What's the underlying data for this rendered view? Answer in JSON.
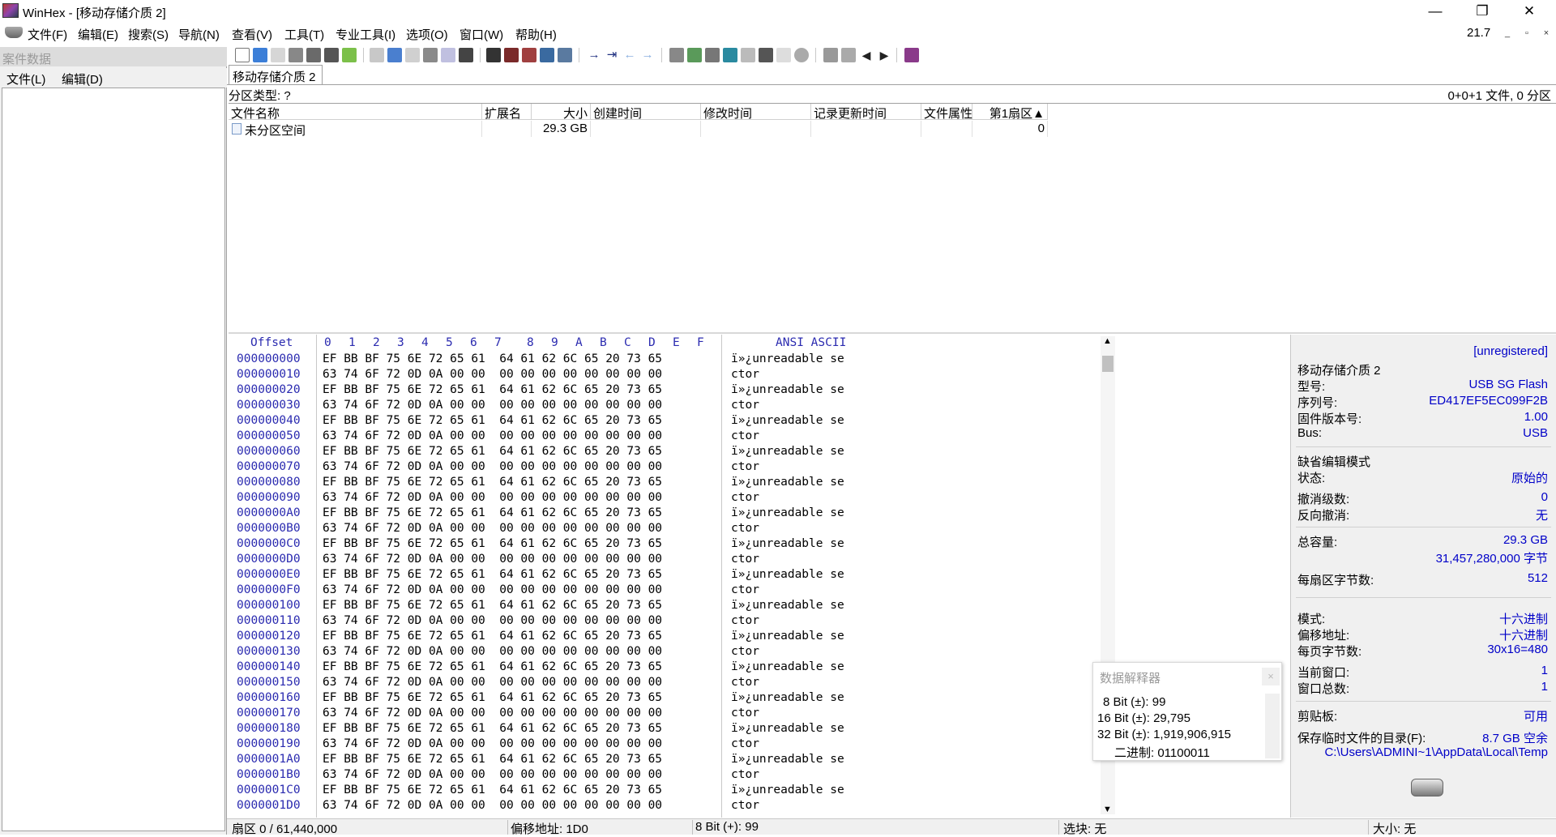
{
  "window": {
    "title": "WinHex - [移动存储介质 2]",
    "minimize": "—",
    "restore": "❐",
    "close": "✕"
  },
  "menu": {
    "items": [
      "文件(F)",
      "编辑(E)",
      "搜索(S)",
      "导航(N)",
      "查看(V)",
      "工具(T)",
      "专业工具(I)",
      "选项(O)",
      "窗口(W)",
      "帮助(H)"
    ],
    "version": "21.7",
    "mini_min": "_",
    "mini_restore": "▫",
    "mini_close": "×"
  },
  "left_panel": {
    "header": "案件数据",
    "menu": [
      "文件(L)",
      "编辑(D)"
    ]
  },
  "tab": {
    "label": "移动存储介质 2"
  },
  "partition": {
    "type_label": "分区类型: ?",
    "summary": "0+0+1 文件, 0 分区"
  },
  "file_table": {
    "headers": [
      "文件名称",
      "扩展名",
      "大小",
      "创建时间",
      "修改时间",
      "记录更新时间",
      "文件属性",
      "第1扇区▲"
    ],
    "rows": [
      {
        "name": "未分区空间",
        "ext": "",
        "size": "29.3 GB",
        "created": "",
        "modified": "",
        "record": "",
        "attr": "",
        "first_sector": "0"
      }
    ]
  },
  "hex": {
    "offset_header": "Offset",
    "col_headers": [
      "0",
      "1",
      "2",
      "3",
      "4",
      "5",
      "6",
      "7",
      "8",
      "9",
      "A",
      "B",
      "C",
      "D",
      "E",
      "F"
    ],
    "ascii_header": "ANSI ASCII",
    "row_a_bytes": "EF BB BF 75 6E 72 65 61  64 61 62 6C 65 20 73 65",
    "row_a_text": "ï»¿unreadable se",
    "row_b_bytes": "63 74 6F 72 0D 0A 00 00  00 00 00 00 00 00 00 00",
    "row_b_text": "ctor",
    "offsets": [
      "000000000",
      "000000010",
      "000000020",
      "000000030",
      "000000040",
      "000000050",
      "000000060",
      "000000070",
      "000000080",
      "000000090",
      "0000000A0",
      "0000000B0",
      "0000000C0",
      "0000000D0",
      "0000000E0",
      "0000000F0",
      "000000100",
      "000000110",
      "000000120",
      "000000130",
      "000000140",
      "000000150",
      "000000160",
      "000000170",
      "000000180",
      "000000190",
      "0000001A0",
      "0000001B0",
      "0000001C0",
      "0000001D0"
    ]
  },
  "info": {
    "unregistered": "[unregistered]",
    "device_name": "移动存储介质 2",
    "model_k": "型号:",
    "model_v": "USB SG Flash",
    "serial_k": "序列号:",
    "serial_v": "ED417EF5EC099F2B",
    "firmware_k": "固件版本号:",
    "firmware_v": "1.00",
    "bus_k": "Bus:",
    "bus_v": "USB",
    "edit_mode": "缺省编辑模式",
    "state_k": "状态:",
    "state_v": "原始的",
    "undo_k": "撤消级数:",
    "undo_v": "0",
    "redo_k": "反向撤消:",
    "redo_v": "无",
    "capacity_k": "总容量:",
    "capacity_v": "29.3 GB",
    "capacity_bytes": "31,457,280,000 字节",
    "bps_k": "每扇区字节数:",
    "bps_v": "512",
    "mode_k": "模式:",
    "mode_v": "十六进制",
    "offaddr_k": "偏移地址:",
    "offaddr_v": "十六进制",
    "bpp_k": "每页字节数:",
    "bpp_v": "30x16=480",
    "curwin_k": "当前窗口:",
    "curwin_v": "1",
    "totwin_k": "窗口总数:",
    "totwin_v": "1",
    "clip_k": "剪贴板:",
    "clip_v": "可用",
    "temp_k": "保存临时文件的目录(F):",
    "temp_v": "8.7 GB 空余",
    "temp_path": "C:\\Users\\ADMINI~1\\AppData\\Local\\Temp"
  },
  "interpreter": {
    "title": "数据解释器",
    "close": "×",
    "lines": [
      "8 Bit (±): 99",
      "16 Bit (±): 29,795",
      "32 Bit (±): 1,919,906,915",
      "二进制: 01100011"
    ]
  },
  "status": {
    "sector": "扇区 0 / 61,440,000",
    "offset": "偏移地址: 1D0",
    "bit8": "8 Bit (+): 99",
    "selection": "选块: 无",
    "size": "大小: 无"
  }
}
